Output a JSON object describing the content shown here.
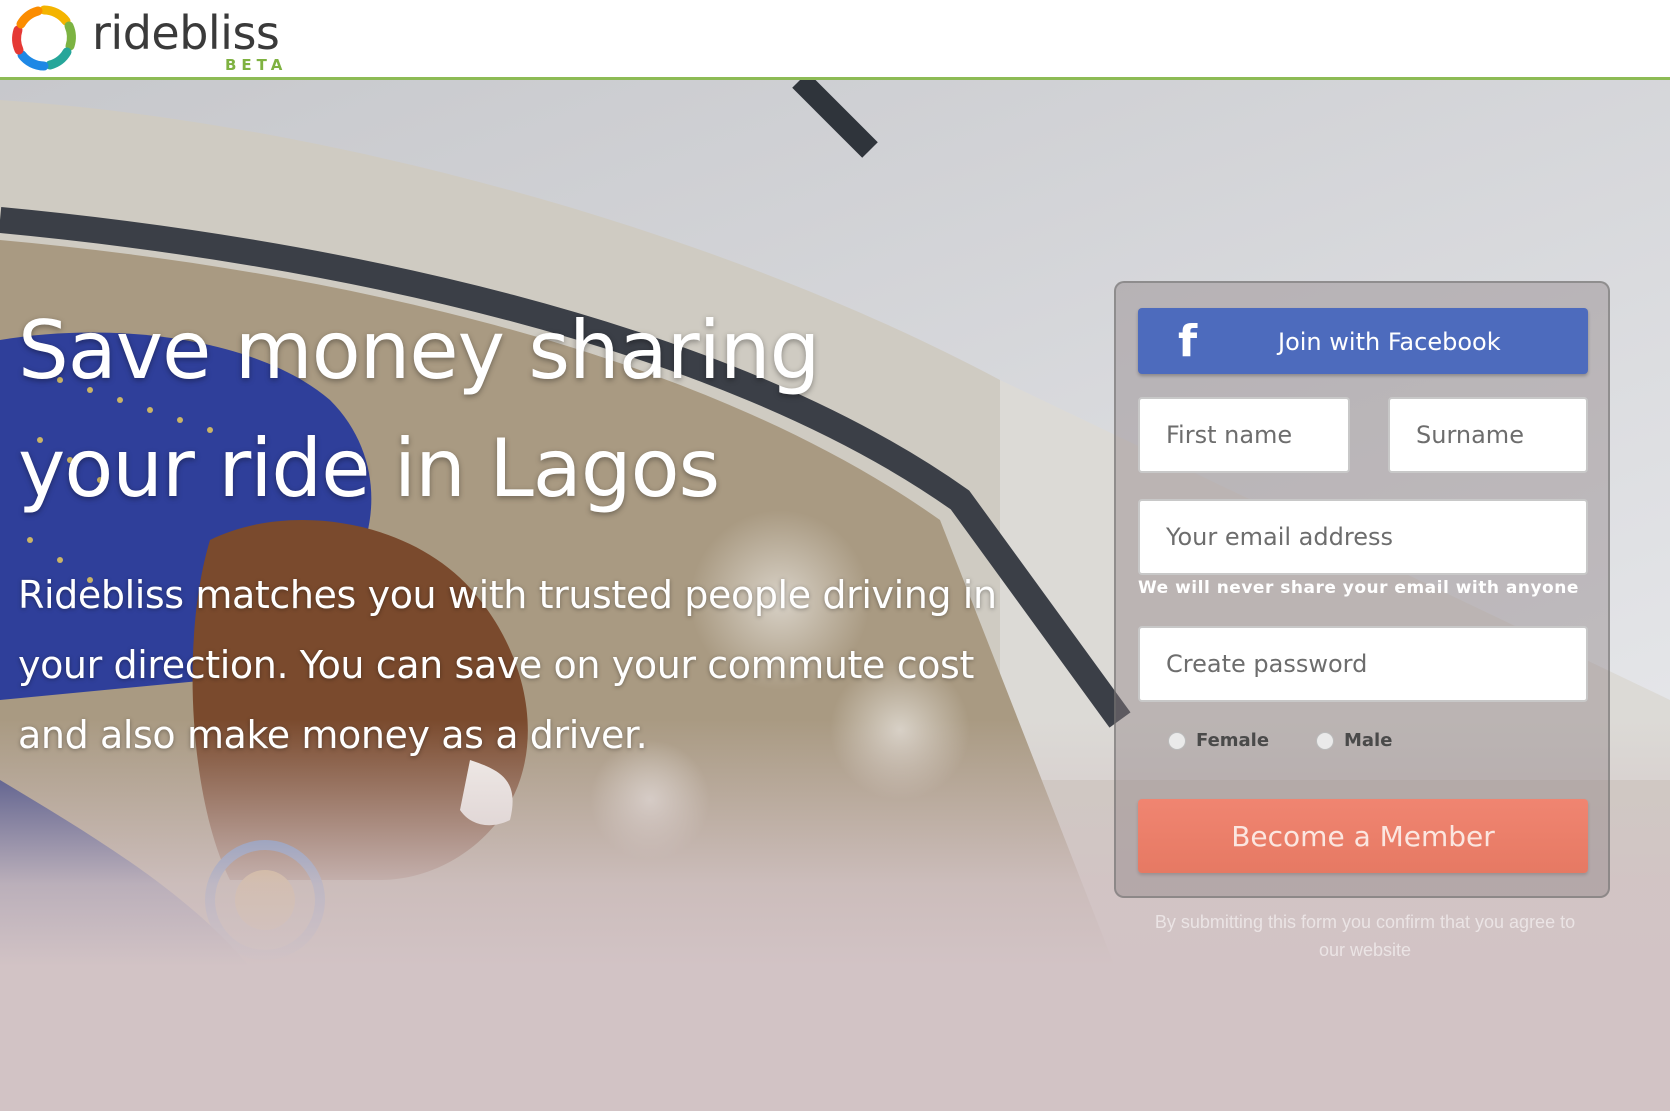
{
  "brand": {
    "name": "ridebliss",
    "tag": "BETA",
    "colors": {
      "green": "#8dbb55",
      "facebook": "#4d6bbd",
      "cta": "#ec806b"
    }
  },
  "hero": {
    "headline": "Save money sharing your ride in Lagos",
    "subtext": "Ridebliss matches you with trusted people driving in your direction. You can save on your commute cost and also make money as a driver."
  },
  "form": {
    "facebook_button": {
      "icon": "facebook-f-icon",
      "label": "Join with Facebook"
    },
    "first_name_placeholder": "First name",
    "surname_placeholder": "Surname",
    "email_placeholder": "Your email address",
    "email_hint": "We will never share your email with anyone",
    "password_placeholder": "Create password",
    "gender_options": [
      "Female",
      "Male"
    ],
    "submit_label": "Become a Member",
    "terms_text": "By submitting this form you confirm that you agree to our website"
  }
}
